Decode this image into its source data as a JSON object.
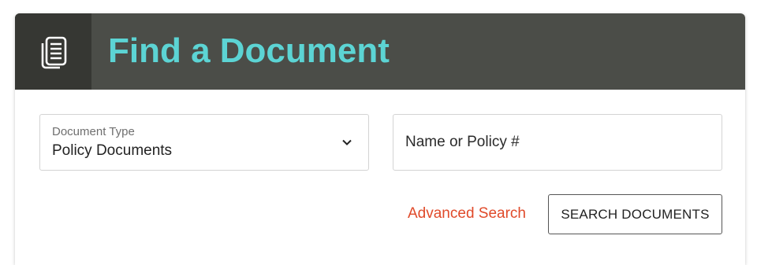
{
  "header": {
    "icon": "document-icon",
    "title_prefix": "Find a ",
    "title_emphasis": "Document"
  },
  "document_type": {
    "label": "Document Type",
    "selected": "Policy Documents"
  },
  "search": {
    "placeholder": "Name or Policy #",
    "value": ""
  },
  "actions": {
    "advanced_search": "Advanced Search",
    "search_button": "SEARCH DOCUMENTS"
  },
  "colors": {
    "header_bg": "#4b4d48",
    "icon_box_bg": "#363733",
    "title_accent": "#5cd4d4",
    "link": "#e04a2a"
  }
}
